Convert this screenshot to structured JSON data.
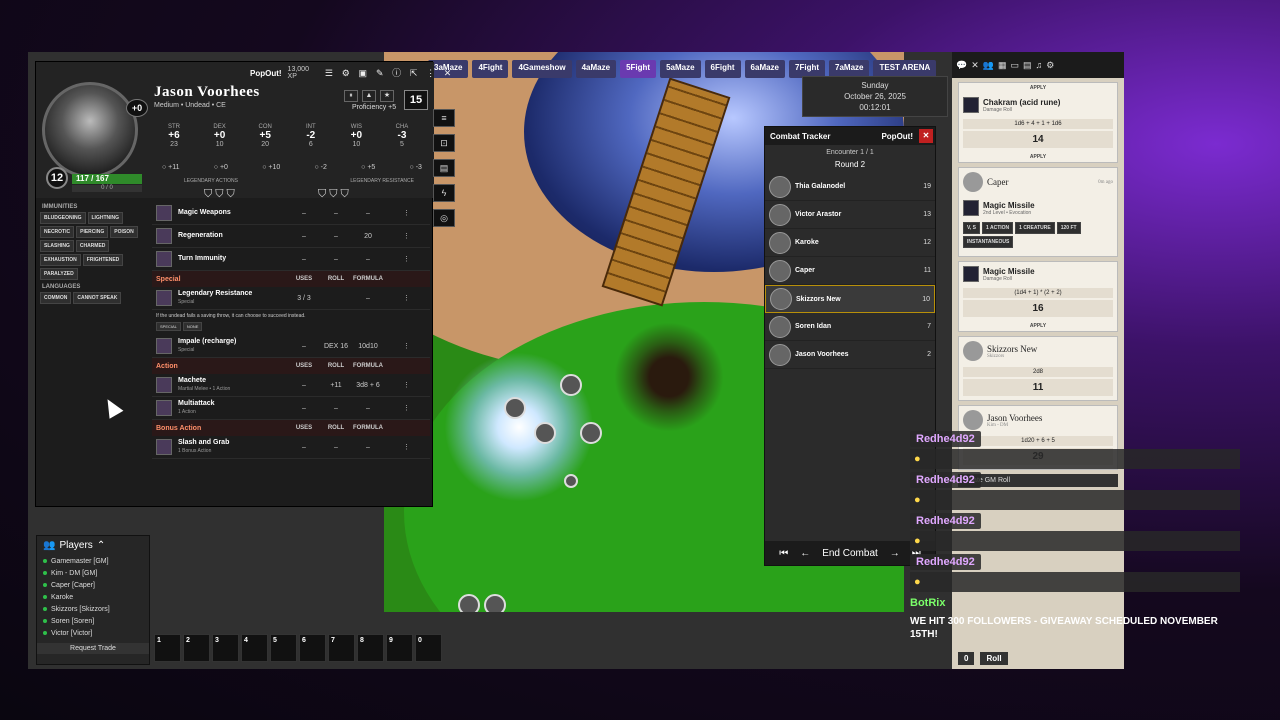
{
  "scenes": [
    "3aMaze",
    "4Fight",
    "4Gameshow",
    "4aMaze",
    "5Fight",
    "5aMaze",
    "6Fight",
    "6aMaze",
    "7Fight",
    "7aMaze",
    "TEST ARENA"
  ],
  "active_scene": "5Fight",
  "clock": {
    "day": "Sunday",
    "date": "October 26, 2025",
    "time": "00:12:01"
  },
  "sheet": {
    "popout": "PopOut!",
    "xp": "13,000 XP",
    "name": "Jason Voorhees",
    "subtitle": "Medium • Undead • CE",
    "level": "12",
    "portrait_bonus": "+0",
    "hp": "117 / 167",
    "hp_sub": "0 / 0",
    "initiative": "15",
    "proficiency": "Proficiency +5",
    "abilities": [
      {
        "k": "STR",
        "v": "+6",
        "s": "23"
      },
      {
        "k": "DEX",
        "v": "+0",
        "s": "10"
      },
      {
        "k": "CON",
        "v": "+5",
        "s": "20"
      },
      {
        "k": "INT",
        "v": "-2",
        "s": "6"
      },
      {
        "k": "WIS",
        "v": "+0",
        "s": "10"
      },
      {
        "k": "CHA",
        "v": "-3",
        "s": "5"
      }
    ],
    "saves": [
      "+11",
      "+0",
      "+10",
      "-2",
      "+5",
      "-3"
    ],
    "legendary_actions_label": "LEGENDARY ACTIONS",
    "legendary_resistance_label": "LEGENDARY RESISTANCE",
    "immunities_label": "IMMUNITIES",
    "immunities": [
      "BLUDGEONING",
      "LIGHTNING",
      "NECROTIC",
      "PIERCING",
      "POISON",
      "SLASHING",
      "CHARMED",
      "EXHAUSTION",
      "FRIGHTENED",
      "PARALYZED"
    ],
    "languages_label": "LANGUAGES",
    "languages": [
      "COMMON",
      "CANNOT SPEAK"
    ],
    "features": [
      {
        "name": "Magic Weapons",
        "sub": "",
        "a": "–",
        "b": "–",
        "c": "–"
      },
      {
        "name": "Regeneration",
        "sub": "",
        "a": "–",
        "b": "–",
        "c": "20"
      },
      {
        "name": "Turn Immunity",
        "sub": "",
        "a": "–",
        "b": "–",
        "c": "–"
      }
    ],
    "special": {
      "title": "Special",
      "uses": "USES",
      "roll": "ROLL",
      "formula": "FORMULA",
      "items": [
        {
          "name": "Legendary Resistance",
          "sub": "Special",
          "a": "3 / 3",
          "b": "",
          "c": "–"
        }
      ],
      "desc": "If the undead fails a saving throw, it can choose to succeed instead.",
      "tags": [
        "SPECIAL",
        "NONE"
      ],
      "impale": {
        "name": "Impale (recharge)",
        "sub": "Special",
        "a": "–",
        "b": "DEX 16",
        "c": "10d10"
      }
    },
    "action": {
      "title": "Action",
      "uses": "USES",
      "roll": "ROLL",
      "formula": "FORMULA",
      "items": [
        {
          "name": "Machete",
          "sub": "Martial Melee • 1 Action",
          "a": "–",
          "b": "+11",
          "c": "3d8 + 6"
        },
        {
          "name": "Multiattack",
          "sub": "1 Action",
          "a": "–",
          "b": "–",
          "c": "–"
        }
      ]
    },
    "bonus": {
      "title": "Bonus Action",
      "uses": "USES",
      "roll": "ROLL",
      "formula": "FORMULA",
      "items": [
        {
          "name": "Slash and Grab",
          "sub": "1 Bonus Action",
          "a": "–",
          "b": "–",
          "c": "–"
        }
      ]
    }
  },
  "players": {
    "title": "Players",
    "list": [
      "Gamemaster [GM]",
      "Kim - DM [GM]",
      "Caper [Caper]",
      "Karoke",
      "Skizzors [Skizzors]",
      "Soren [Soren]",
      "Victor [Victor]"
    ],
    "trade": "Request Trade"
  },
  "hotbar": [
    "1",
    "2",
    "3",
    "4",
    "5",
    "6",
    "7",
    "8",
    "9",
    "0"
  ],
  "combat": {
    "title": "Combat Tracker",
    "popout": "PopOut!",
    "encounter": "Encounter 1 / 1",
    "round": "Round 2",
    "combatants": [
      {
        "name": "Thia Galanodel",
        "init": "19"
      },
      {
        "name": "Victor Arastor",
        "init": "13"
      },
      {
        "name": "Karoke",
        "init": "12"
      },
      {
        "name": "Caper",
        "init": "11"
      },
      {
        "name": "Skizzors New",
        "init": "10"
      },
      {
        "name": "Soren Idan",
        "init": "7"
      },
      {
        "name": "Jason Voorhees",
        "init": "2"
      }
    ],
    "active_index": 4,
    "end": "End Combat"
  },
  "chat": {
    "cards": [
      {
        "apply": "APPLY",
        "title": "Chakram (acid rune)",
        "sub": "Damage Roll",
        "formula": "1d6 + 4 + 1 + 1d6",
        "result": "14"
      },
      {
        "speaker": "Caper",
        "ago": "0m ago",
        "title": "Magic Missile",
        "sub": "2nd Level • Evocation",
        "tags": [
          "V, S",
          "1 ACTION",
          "1 CREATURE",
          "120 FT",
          "INSTANTANEOUS"
        ]
      },
      {
        "title": "Magic Missile",
        "sub": "Damage Roll",
        "formula": "(1d4 + 1) * (2 + 2)",
        "result": "16"
      },
      {
        "speaker": "Skizzors New",
        "sub": "Skizzors",
        "formula": "2d8",
        "result": "11"
      },
      {
        "speaker": "Jason Voorhees",
        "sub": "Kim - DM",
        "formula": "1d20 + 6 + 5",
        "result": "29"
      }
    ],
    "roll_mode": "Private GM Roll",
    "roll_btn": "Roll",
    "roll_count": "0"
  },
  "stream": {
    "names": [
      "Redhe4d92",
      "Redhe4d92",
      "Redhe4d92",
      "Redhe4d92"
    ],
    "bot": "BotRix",
    "bot_msg": "WE HIT 300 FOLLOWERS - GIVEAWAY SCHEDULED NOVEMBER 15TH!"
  },
  "colors": {
    "accent": "#6a3ab0",
    "hp": "#2f8a2a",
    "danger": "#c02020",
    "header_red": "#ff8f6a"
  }
}
